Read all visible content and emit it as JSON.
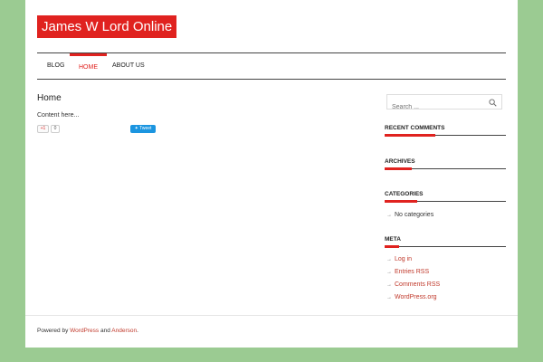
{
  "site": {
    "title": "James W Lord Online"
  },
  "nav": {
    "items": [
      {
        "label": "BLOG"
      },
      {
        "label": "HOME"
      },
      {
        "label": "ABOUT US"
      }
    ]
  },
  "main": {
    "title": "Home",
    "content": "Content here...",
    "share": {
      "gplus_label": "+1",
      "gplus_count": "0",
      "tweet_label": "Tweet"
    }
  },
  "sidebar": {
    "search_placeholder": "Search ...",
    "widgets": {
      "recent_comments": {
        "title": "RECENT COMMENTS"
      },
      "archives": {
        "title": "ARCHIVES"
      },
      "categories": {
        "title": "CATEGORIES",
        "items": [
          "No categories"
        ]
      },
      "meta": {
        "title": "META",
        "items": [
          "Log in",
          "Entries RSS",
          "Comments RSS",
          "WordPress.org"
        ]
      }
    }
  },
  "footer": {
    "prefix": "Powered by",
    "link1": "WordPress",
    "middle": "and",
    "link2": "Anderson",
    "suffix": "."
  },
  "colors": {
    "accent": "#e0221f",
    "background": "#9bcb92",
    "link": "#c0392b"
  }
}
